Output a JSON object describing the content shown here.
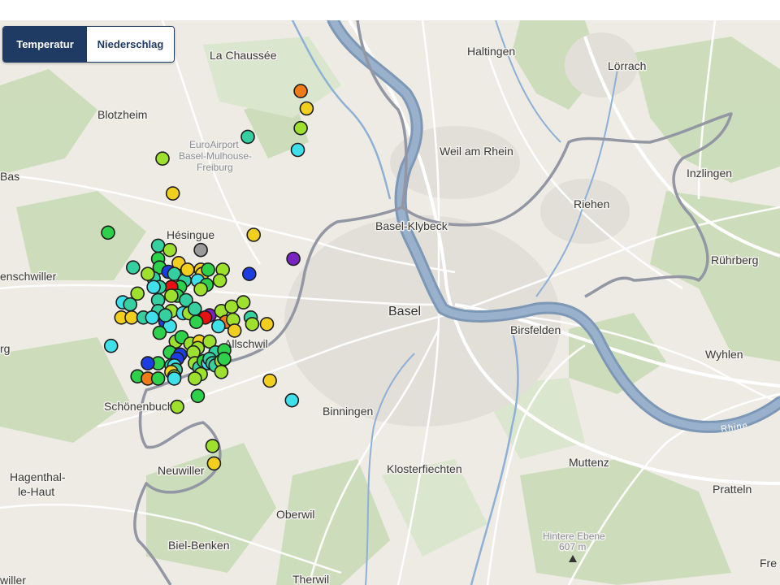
{
  "controls": {
    "temperature_label": "Temperatur",
    "precipitation_label": "Niederschlag",
    "active": "temperature"
  },
  "places": {
    "la_chaussee": "La Chaussée",
    "haltingen": "Haltingen",
    "loerrach": "Lörrach",
    "blotzheim": "Blotzheim",
    "euroairport_1": "EuroAirport",
    "euroairport_2": "Basel-Mulhouse-",
    "euroairport_3": "Freiburg",
    "weil_am_rhein": "Weil am Rhein",
    "bas": "Bas",
    "inzlingen": "Inzlingen",
    "riehen": "Riehen",
    "basel_kleinbasel": "Basel-Klybeck",
    "hesingue": "Hésingue",
    "ruehrberg": "Rührberg",
    "hegenheim": "enschwiller",
    "basel": "Basel",
    "birsfelden": "Birsfelden",
    "allschwil": "Allschwil",
    "wyhlen": "Wyhlen",
    "rg": "rg",
    "schoenenbuch": "Schönenbuch",
    "binningen": "Binningen",
    "rhine": "Rhine",
    "muttenz": "Muttenz",
    "hagenthal_1": "Hagenthal-",
    "hagenthal_2": "le-Haut",
    "neuwiller": "Neuwiller",
    "klosterfiechten": "Klosterfiechten",
    "pratteln": "Pratteln",
    "oberwil": "Oberwil",
    "hintere_ebene": "Hintere Ebene",
    "hintere_ebene_elev": "607 m",
    "biel_benken": "Biel-Benken",
    "fre": "Fre",
    "therwil": "Therwil",
    "willer": "willer"
  },
  "colors": {
    "purple": "#7b22c4",
    "blue": "#1e3de0",
    "cyan": "#3fe0ea",
    "teal": "#35cfa0",
    "green": "#2ed14a",
    "lime": "#9ee02e",
    "yellow": "#f2cf1e",
    "orange": "#f07a16",
    "red": "#e81010",
    "gray": "#9a9a9a"
  },
  "stations": [
    {
      "x": 7.642,
      "y": 47.635,
      "c": "orange"
    },
    {
      "x": 7.646,
      "y": 47.627,
      "c": "yellow"
    },
    {
      "x": 7.642,
      "y": 47.618,
      "c": "lime"
    },
    {
      "x": 7.606,
      "y": 47.614,
      "c": "teal"
    },
    {
      "x": 7.64,
      "y": 47.608,
      "c": "cyan"
    },
    {
      "x": 7.548,
      "y": 47.604,
      "c": "lime"
    },
    {
      "x": 7.555,
      "y": 47.588,
      "c": "yellow"
    },
    {
      "x": 7.511,
      "y": 47.57,
      "c": "green"
    },
    {
      "x": 7.61,
      "y": 47.569,
      "c": "yellow"
    },
    {
      "x": 7.637,
      "y": 47.558,
      "c": "purple"
    },
    {
      "x": 7.528,
      "y": 47.554,
      "c": "teal"
    },
    {
      "x": 7.545,
      "y": 47.564,
      "c": "teal"
    },
    {
      "x": 7.545,
      "y": 47.558,
      "c": "green"
    },
    {
      "x": 7.546,
      "y": 47.554,
      "c": "green"
    },
    {
      "x": 7.553,
      "y": 47.562,
      "c": "lime"
    },
    {
      "x": 7.559,
      "y": 47.556,
      "c": "yellow"
    },
    {
      "x": 7.552,
      "y": 47.552,
      "c": "blue"
    },
    {
      "x": 7.556,
      "y": 47.551,
      "c": "teal"
    },
    {
      "x": 7.574,
      "y": 47.562,
      "c": "gray"
    },
    {
      "x": 7.563,
      "y": 47.548,
      "c": "teal"
    },
    {
      "x": 7.56,
      "y": 47.545,
      "c": "green"
    },
    {
      "x": 7.542,
      "y": 47.549,
      "c": "teal"
    },
    {
      "x": 7.538,
      "y": 47.551,
      "c": "lime"
    },
    {
      "x": 7.554,
      "y": 47.545,
      "c": "red"
    },
    {
      "x": 7.558,
      "y": 47.541,
      "c": "green"
    },
    {
      "x": 7.546,
      "y": 47.545,
      "c": "teal"
    },
    {
      "x": 7.542,
      "y": 47.545,
      "c": "cyan"
    },
    {
      "x": 7.554,
      "y": 47.541,
      "c": "lime"
    },
    {
      "x": 7.574,
      "y": 47.553,
      "c": "yellow"
    },
    {
      "x": 7.575,
      "y": 47.551,
      "c": "yellow"
    },
    {
      "x": 7.572,
      "y": 47.548,
      "c": "cyan"
    },
    {
      "x": 7.579,
      "y": 47.553,
      "c": "green"
    },
    {
      "x": 7.578,
      "y": 47.546,
      "c": "green"
    },
    {
      "x": 7.565,
      "y": 47.553,
      "c": "yellow"
    },
    {
      "x": 7.589,
      "y": 47.553,
      "c": "lime"
    },
    {
      "x": 7.587,
      "y": 47.548,
      "c": "lime"
    },
    {
      "x": 7.607,
      "y": 47.551,
      "c": "blue"
    },
    {
      "x": 7.531,
      "y": 47.542,
      "c": "lime"
    },
    {
      "x": 7.545,
      "y": 47.539,
      "c": "teal"
    },
    {
      "x": 7.545,
      "y": 47.534,
      "c": "teal"
    },
    {
      "x": 7.554,
      "y": 47.534,
      "c": "lime"
    },
    {
      "x": 7.564,
      "y": 47.539,
      "c": "teal"
    },
    {
      "x": 7.562,
      "y": 47.533,
      "c": "cyan"
    },
    {
      "x": 7.566,
      "y": 47.533,
      "c": "lime"
    },
    {
      "x": 7.57,
      "y": 47.535,
      "c": "teal"
    },
    {
      "x": 7.574,
      "y": 47.544,
      "c": "lime"
    },
    {
      "x": 7.58,
      "y": 47.532,
      "c": "purple"
    },
    {
      "x": 7.577,
      "y": 47.531,
      "c": "red"
    },
    {
      "x": 7.571,
      "y": 47.529,
      "c": "green"
    },
    {
      "x": 7.588,
      "y": 47.534,
      "c": "lime"
    },
    {
      "x": 7.595,
      "y": 47.536,
      "c": "lime"
    },
    {
      "x": 7.603,
      "y": 47.538,
      "c": "lime"
    },
    {
      "x": 7.608,
      "y": 47.531,
      "c": "teal"
    },
    {
      "x": 7.591,
      "y": 47.529,
      "c": "orange"
    },
    {
      "x": 7.596,
      "y": 47.53,
      "c": "lime"
    },
    {
      "x": 7.609,
      "y": 47.528,
      "c": "lime"
    },
    {
      "x": 7.586,
      "y": 47.527,
      "c": "cyan"
    },
    {
      "x": 7.597,
      "y": 47.525,
      "c": "yellow"
    },
    {
      "x": 7.619,
      "y": 47.528,
      "c": "yellow"
    },
    {
      "x": 7.521,
      "y": 47.538,
      "c": "cyan"
    },
    {
      "x": 7.526,
      "y": 47.537,
      "c": "teal"
    },
    {
      "x": 7.52,
      "y": 47.531,
      "c": "yellow"
    },
    {
      "x": 7.527,
      "y": 47.531,
      "c": "yellow"
    },
    {
      "x": 7.535,
      "y": 47.531,
      "c": "teal"
    },
    {
      "x": 7.541,
      "y": 47.531,
      "c": "cyan"
    },
    {
      "x": 7.55,
      "y": 47.529,
      "c": "blue"
    },
    {
      "x": 7.553,
      "y": 47.527,
      "c": "cyan"
    },
    {
      "x": 7.55,
      "y": 47.532,
      "c": "teal"
    },
    {
      "x": 7.546,
      "y": 47.524,
      "c": "green"
    },
    {
      "x": 7.557,
      "y": 47.52,
      "c": "lime"
    },
    {
      "x": 7.561,
      "y": 47.522,
      "c": "green"
    },
    {
      "x": 7.567,
      "y": 47.519,
      "c": "lime"
    },
    {
      "x": 7.573,
      "y": 47.52,
      "c": "yellow"
    },
    {
      "x": 7.572,
      "y": 47.517,
      "c": "lime"
    },
    {
      "x": 7.58,
      "y": 47.52,
      "c": "lime"
    },
    {
      "x": 7.584,
      "y": 47.515,
      "c": "teal"
    },
    {
      "x": 7.59,
      "y": 47.516,
      "c": "green"
    },
    {
      "x": 7.513,
      "y": 47.518,
      "c": "cyan"
    },
    {
      "x": 7.553,
      "y": 47.515,
      "c": "green"
    },
    {
      "x": 7.56,
      "y": 47.514,
      "c": "blue"
    },
    {
      "x": 7.558,
      "y": 47.512,
      "c": "blue"
    },
    {
      "x": 7.554,
      "y": 47.509,
      "c": "teal"
    },
    {
      "x": 7.556,
      "y": 47.509,
      "c": "cyan"
    },
    {
      "x": 7.557,
      "y": 47.507,
      "c": "teal"
    },
    {
      "x": 7.554,
      "y": 47.506,
      "c": "yellow"
    },
    {
      "x": 7.556,
      "y": 47.504,
      "c": "lime"
    },
    {
      "x": 7.545,
      "y": 47.51,
      "c": "green"
    },
    {
      "x": 7.538,
      "y": 47.51,
      "c": "blue"
    },
    {
      "x": 7.531,
      "y": 47.504,
      "c": "green"
    },
    {
      "x": 7.538,
      "y": 47.503,
      "c": "orange"
    },
    {
      "x": 7.545,
      "y": 47.503,
      "c": "green"
    },
    {
      "x": 7.556,
      "y": 47.503,
      "c": "cyan"
    },
    {
      "x": 7.569,
      "y": 47.515,
      "c": "lime"
    },
    {
      "x": 7.57,
      "y": 47.51,
      "c": "lime"
    },
    {
      "x": 7.573,
      "y": 47.508,
      "c": "teal"
    },
    {
      "x": 7.576,
      "y": 47.511,
      "c": "green"
    },
    {
      "x": 7.579,
      "y": 47.51,
      "c": "cyan"
    },
    {
      "x": 7.58,
      "y": 47.512,
      "c": "teal"
    },
    {
      "x": 7.582,
      "y": 47.51,
      "c": "teal"
    },
    {
      "x": 7.584,
      "y": 47.509,
      "c": "teal"
    },
    {
      "x": 7.588,
      "y": 47.511,
      "c": "lime"
    },
    {
      "x": 7.59,
      "y": 47.512,
      "c": "green"
    },
    {
      "x": 7.588,
      "y": 47.506,
      "c": "lime"
    },
    {
      "x": 7.574,
      "y": 47.505,
      "c": "lime"
    },
    {
      "x": 7.57,
      "y": 47.503,
      "c": "lime"
    },
    {
      "x": 7.572,
      "y": 47.495,
      "c": "green"
    },
    {
      "x": 7.558,
      "y": 47.49,
      "c": "lime"
    },
    {
      "x": 7.621,
      "y": 47.502,
      "c": "yellow"
    },
    {
      "x": 7.636,
      "y": 47.493,
      "c": "cyan"
    },
    {
      "x": 7.582,
      "y": 47.472,
      "c": "lime"
    },
    {
      "x": 7.583,
      "y": 47.464,
      "c": "yellow"
    }
  ]
}
